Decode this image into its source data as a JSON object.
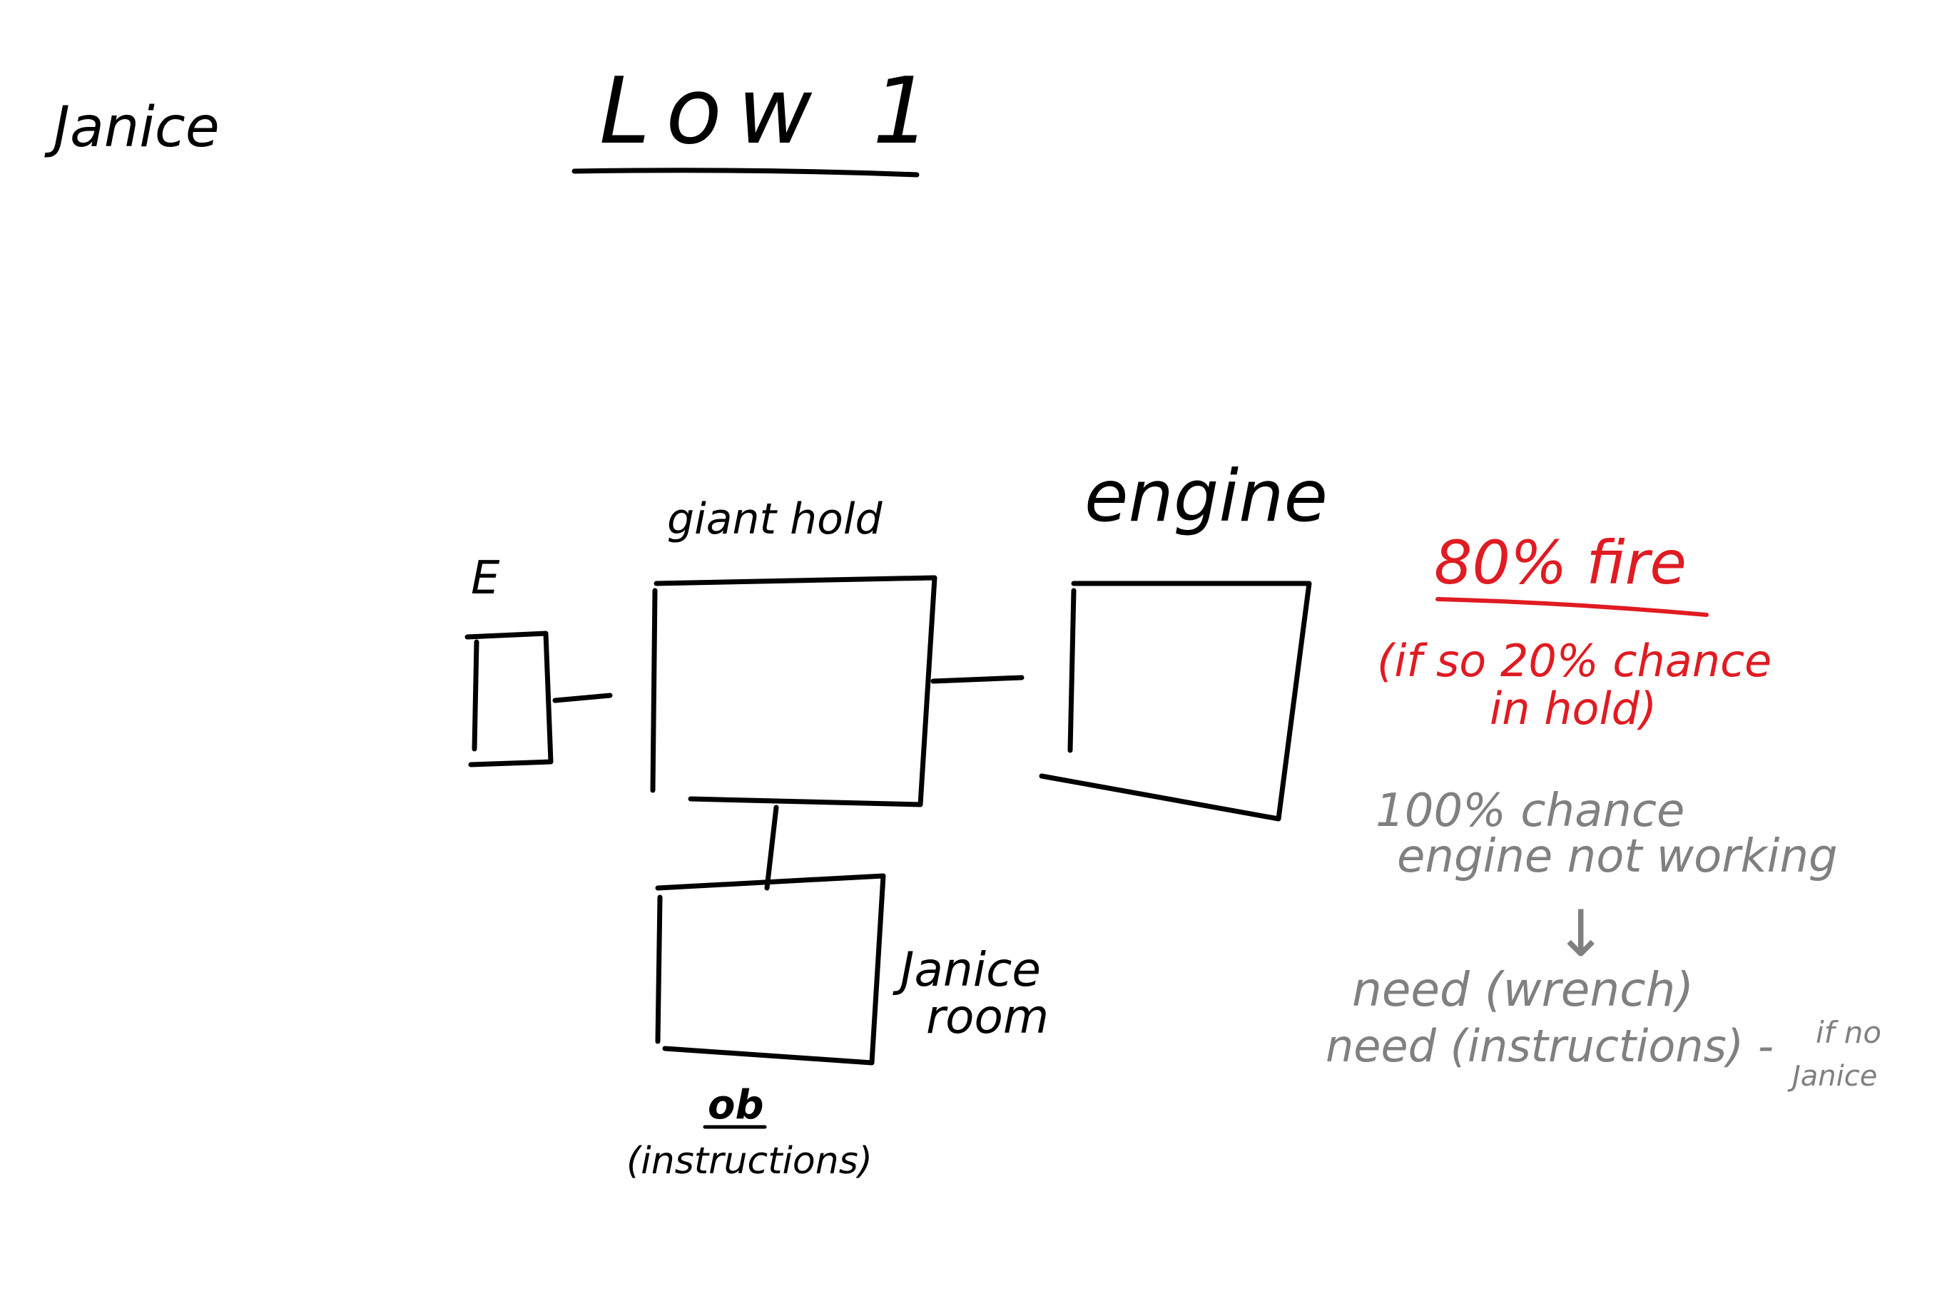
{
  "header": {
    "author": "Janice",
    "title": "Low 1"
  },
  "rooms": {
    "e": {
      "label": "E"
    },
    "giant_hold": {
      "label": "giant hold"
    },
    "engine": {
      "label": "engine"
    },
    "janice_room": {
      "label_line1": "Janice",
      "label_line2": "room"
    }
  },
  "objective": {
    "label": "ob",
    "detail": "(instructions)"
  },
  "notes": {
    "fire": "80% fire",
    "fire_sub_line1": "(if so 20% chance",
    "fire_sub_line2": "in hold)",
    "engine_line1": "100% chance",
    "engine_line2": "engine not working",
    "arrow": "↓",
    "need1": "need (wrench)",
    "need2": "need  (instructions) -",
    "if_no_line1": "if no",
    "if_no_line2": "Janice"
  },
  "colors": {
    "ink": "#000000",
    "fire_note": "#e01b22",
    "engine_note": "#808080"
  }
}
